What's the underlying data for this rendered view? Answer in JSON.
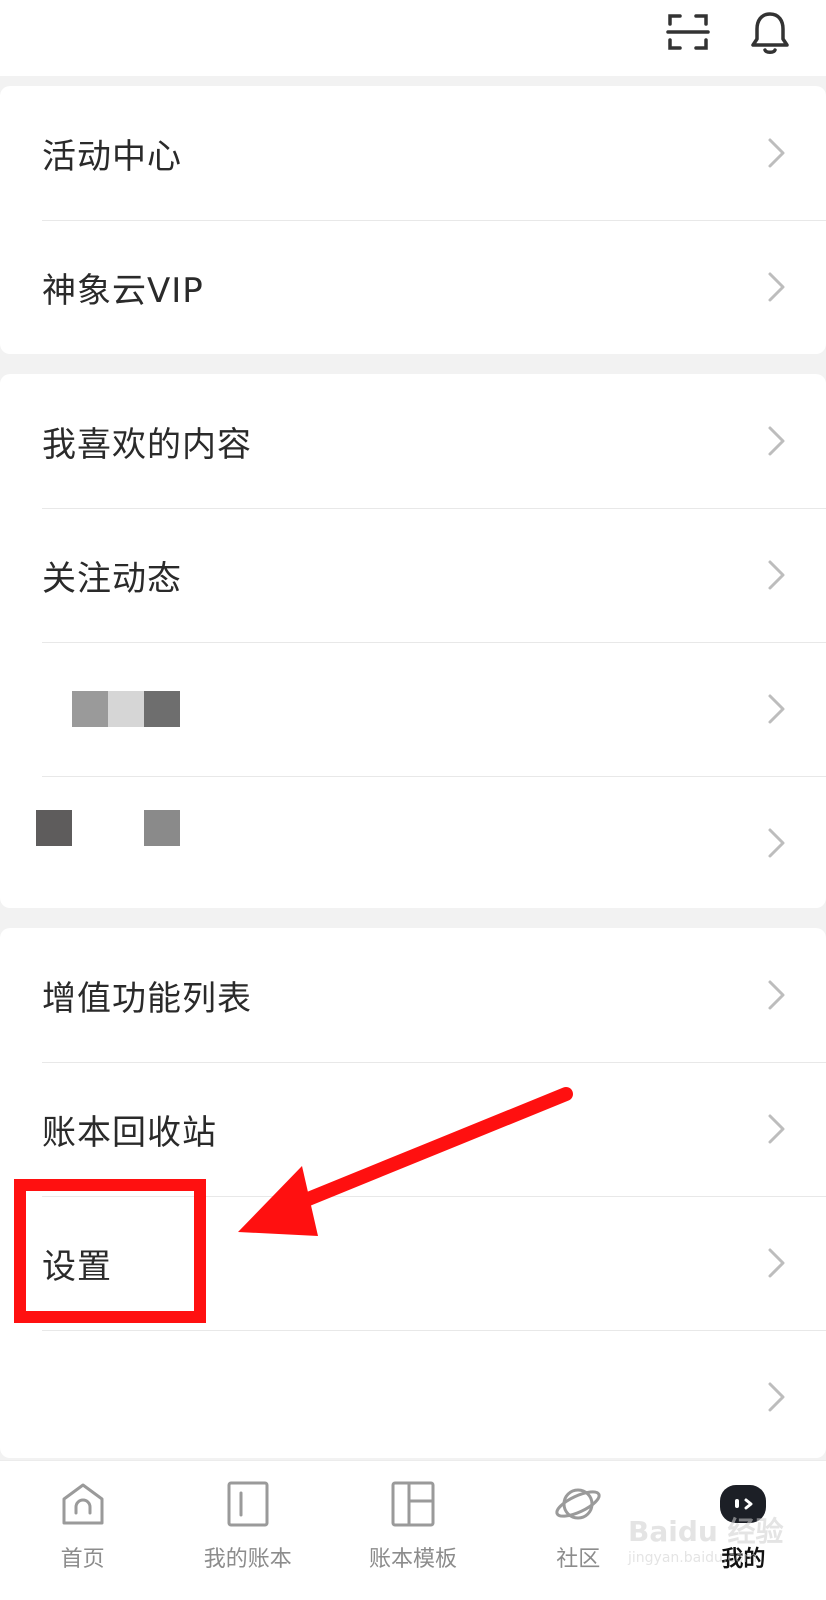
{
  "header": {
    "scan_icon": "scan-icon",
    "bell_icon": "bell-icon"
  },
  "section1": {
    "items": [
      {
        "label": "活动中心"
      },
      {
        "label": "神象云VIP"
      }
    ]
  },
  "section2": {
    "items": [
      {
        "label": "我喜欢的内容"
      },
      {
        "label": "关注动态"
      }
    ]
  },
  "section3": {
    "items": [
      {
        "label": "增值功能列表"
      },
      {
        "label": "账本回收站"
      },
      {
        "label": "设置"
      }
    ]
  },
  "annotation": {
    "highlight_color": "#ff1010"
  },
  "tabbar": {
    "tabs": [
      {
        "label": "首页",
        "icon": "home-icon"
      },
      {
        "label": "我的账本",
        "icon": "book-icon"
      },
      {
        "label": "账本模板",
        "icon": "template-icon"
      },
      {
        "label": "社区",
        "icon": "planet-icon"
      },
      {
        "label": "我的",
        "icon": "profile-mascot-icon"
      }
    ]
  },
  "watermark": {
    "text": "Baidu 经验",
    "subtext": "jingyan.baidu.com"
  }
}
